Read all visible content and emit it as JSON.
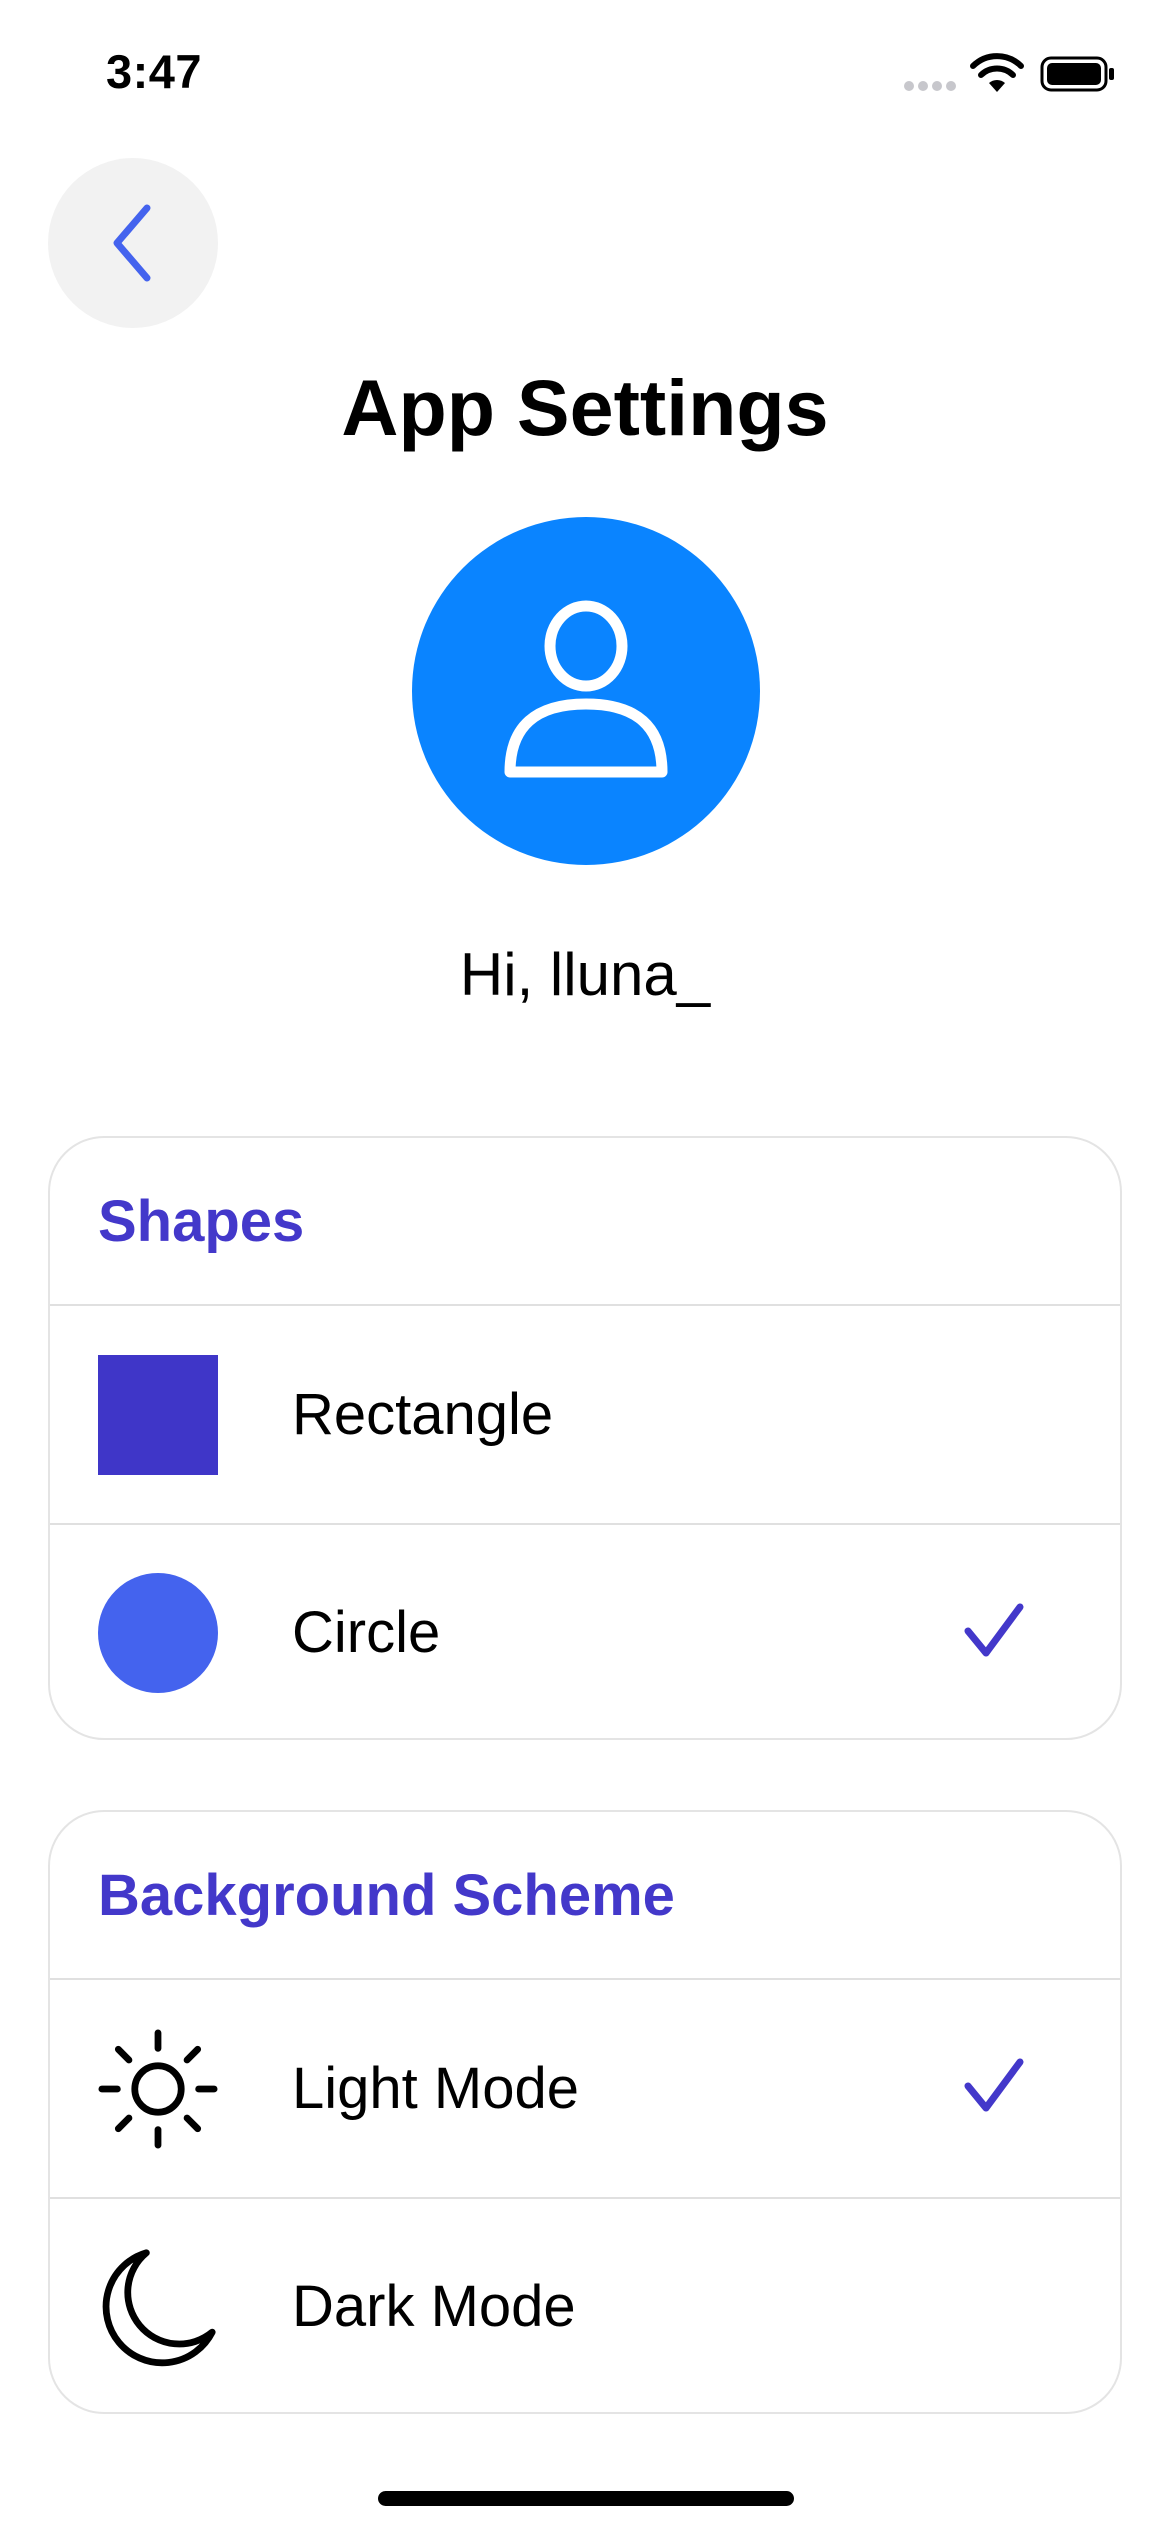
{
  "status_bar": {
    "time": "3:47",
    "icons": [
      "signal-dots-icon",
      "wifi-icon",
      "battery-icon"
    ]
  },
  "header": {
    "back_icon": "chevron-left-icon",
    "title": "App Settings"
  },
  "profile": {
    "avatar_icon": "person-icon",
    "greeting": "Hi, lluna_"
  },
  "shapes_section": {
    "title": "Shapes",
    "options": [
      {
        "label": "Rectangle",
        "icon": "square-icon",
        "selected": false
      },
      {
        "label": "Circle",
        "icon": "circle-icon",
        "selected": true
      }
    ]
  },
  "scheme_section": {
    "title": "Background Scheme",
    "options": [
      {
        "label": "Light Mode",
        "icon": "sun-icon",
        "selected": true
      },
      {
        "label": "Dark Mode",
        "icon": "moon-icon",
        "selected": false
      }
    ]
  },
  "colors": {
    "accent": "#4338ca",
    "avatar_bg": "#0a84ff",
    "rectangle": "#3f36c8",
    "circle": "#4463ee"
  }
}
